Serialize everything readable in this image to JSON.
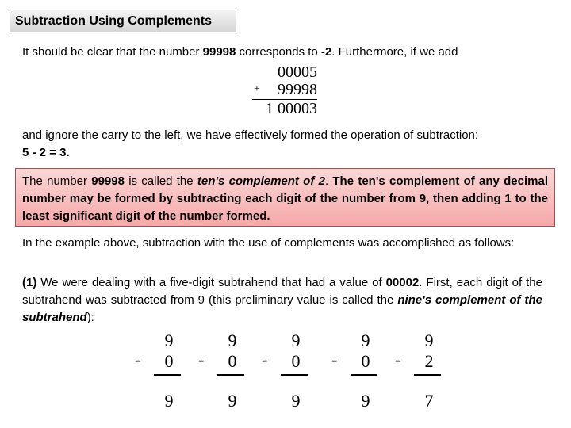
{
  "title": "Subtraction Using Complements",
  "intro": {
    "part1": "It should be clear that the number ",
    "bold1": "99998",
    "part2": " corresponds to ",
    "bold2": "-2",
    "part3": ". Furthermore, if we add"
  },
  "addition_example": {
    "addend1": "00005",
    "operator": "+",
    "addend2": "99998",
    "result": "1 00003"
  },
  "after": {
    "text": "and ignore the carry to the left, we have effectively formed the operation of subtraction:",
    "equation": "5 - 2 = 3."
  },
  "highlight": {
    "part1": "The number ",
    "bold1": "99998",
    "part2": " is called the ",
    "italic": "ten's complement of 2",
    "part3": ". ",
    "bold_rest": "The ten's complement of any decimal number may be formed by subtracting each digit of the number from 9, then adding 1 to the least significant digit of the number formed."
  },
  "example_text": "In the example above, subtraction with the use of complements was accomplished as follows:",
  "step1": {
    "label": "(1)",
    "part1": " We were dealing with a five-digit subtrahend that had a value of ",
    "bold1": "00002",
    "part2": ". First, each digit of the subtrahend was subtracted from 9 (this preliminary value is called the ",
    "italic": "nine's complement of the subtrahend",
    "part3": "):"
  },
  "nines_complement": [
    {
      "minuend": "9",
      "operator": "-",
      "subtrahend": "0",
      "result": "9"
    },
    {
      "minuend": "9",
      "operator": "-",
      "subtrahend": "0",
      "result": "9"
    },
    {
      "minuend": "9",
      "operator": "-",
      "subtrahend": "0",
      "result": "9"
    },
    {
      "minuend": "9",
      "operator": "-",
      "subtrahend": "0",
      "result": "9"
    },
    {
      "minuend": "9",
      "operator": "-",
      "subtrahend": "2",
      "result": "7"
    }
  ]
}
